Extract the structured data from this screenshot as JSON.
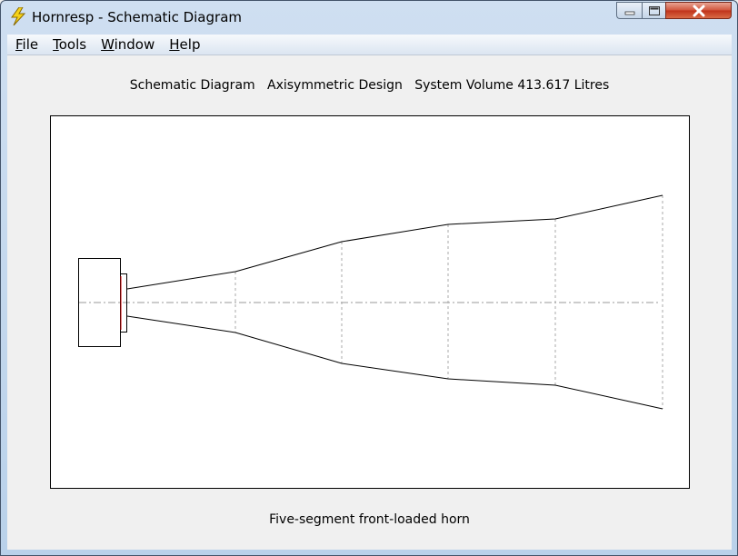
{
  "window": {
    "title": "Hornresp - Schematic Diagram",
    "icon": "lightning-icon"
  },
  "menu": {
    "items": [
      {
        "label": "File",
        "underline": "F"
      },
      {
        "label": "Tools",
        "underline": "T"
      },
      {
        "label": "Window",
        "underline": "W"
      },
      {
        "label": "Help",
        "underline": "H"
      }
    ]
  },
  "diagram": {
    "header": "Schematic Diagram   Axisymmetric Design   System Volume 413.617 Litres",
    "caption": "Five-segment front-loaded horn"
  },
  "colors": {
    "line": "#000000",
    "guide": "#999999",
    "driver_cone": "#cc0000"
  }
}
